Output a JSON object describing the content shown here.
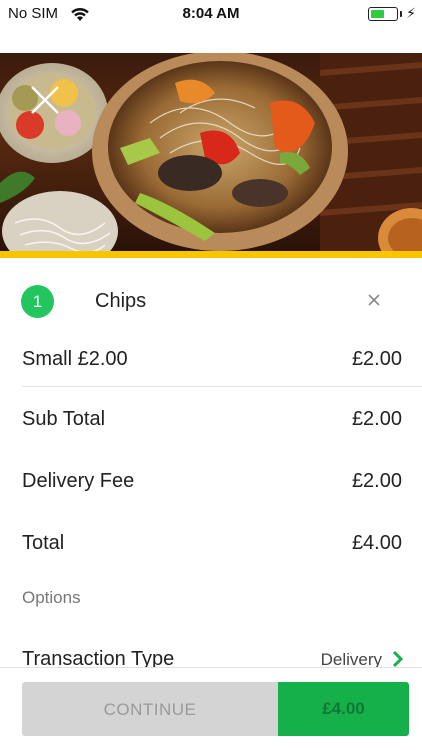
{
  "status_bar": {
    "carrier": "No SIM",
    "time": "8:04 AM",
    "battery_level": 0.55,
    "icons": [
      "wifi-icon",
      "battery-icon",
      "charging-bolt-icon"
    ]
  },
  "hero": {
    "image": "food-photo",
    "close_icon": "close-icon"
  },
  "item": {
    "quantity": "1",
    "name": "Chips",
    "remove_icon": "close-icon"
  },
  "lines": {
    "size_label": "Small £2.00",
    "size_price": "£2.00",
    "subtotal_label": "Sub Total",
    "subtotal_value": "£2.00",
    "delivery_label": "Delivery Fee",
    "delivery_value": "£2.00",
    "total_label": "Total",
    "total_value": "£4.00"
  },
  "options": {
    "heading": "Options",
    "transaction_type_label": "Transaction Type",
    "transaction_type_value": "Delivery"
  },
  "footer": {
    "continue_label": "CONTINUE",
    "price_label": "£4.00"
  },
  "colors": {
    "accent_green": "#22c55e",
    "button_green": "#16b04a",
    "stripe_yellow": "#f7c600",
    "disabled_gray": "#d4d4d4"
  }
}
